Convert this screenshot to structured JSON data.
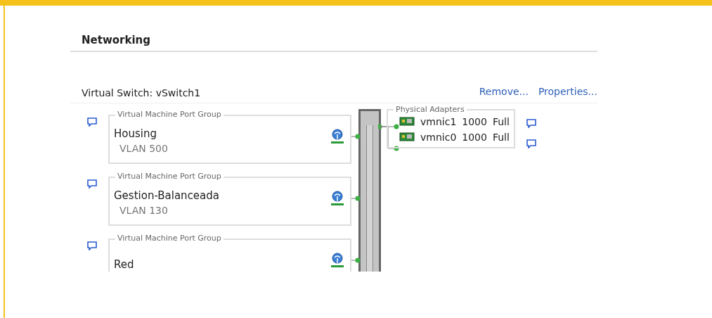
{
  "section_title": "Networking",
  "switch": {
    "label": "Virtual Switch: vSwitch1",
    "links": [
      "Remove...",
      "Properties..."
    ]
  },
  "port_groups": [
    {
      "type_label": "Virtual Machine Port Group",
      "name": "Housing",
      "vlan": "VLAN 500"
    },
    {
      "type_label": "Virtual Machine Port Group",
      "name": "Gestion-Balanceada",
      "vlan": "VLAN 130"
    },
    {
      "type_label": "Virtual Machine Port Group",
      "name": "Red"
    }
  ],
  "physical_adapters": {
    "label": "Physical Adapters",
    "adapters": [
      {
        "name": "vmnic1",
        "speed": "1000",
        "duplex": "Full"
      },
      {
        "name": "vmnic0",
        "speed": "1000",
        "duplex": "Full"
      }
    ]
  }
}
